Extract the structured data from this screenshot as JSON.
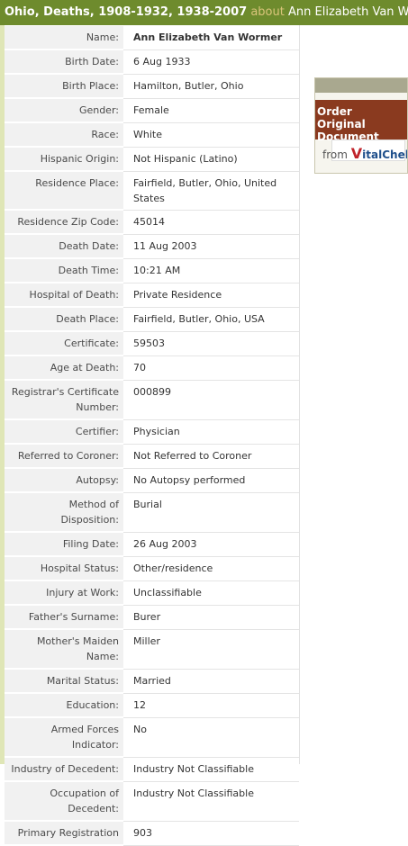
{
  "header": {
    "collection": "Ohio, Deaths, 1908-1932, 1938-2007",
    "about_word": "about",
    "person": "Ann Elizabeth Van Wormer"
  },
  "fields": [
    {
      "label": "Name:",
      "value": "Ann Elizabeth Van Wormer"
    },
    {
      "label": "Birth Date:",
      "value": "6 Aug 1933"
    },
    {
      "label": "Birth Place:",
      "value": "Hamilton, Butler, Ohio"
    },
    {
      "label": "Gender:",
      "value": "Female"
    },
    {
      "label": "Race:",
      "value": "White"
    },
    {
      "label": "Hispanic Origin:",
      "value": "Not Hispanic (Latino)"
    },
    {
      "label": "Residence Place:",
      "value": "Fairfield, Butler, Ohio, United States"
    },
    {
      "label": "Residence Zip Code:",
      "value": "45014"
    },
    {
      "label": "Death Date:",
      "value": "11 Aug 2003"
    },
    {
      "label": "Death Time:",
      "value": "10:21 AM"
    },
    {
      "label": "Hospital of Death:",
      "value": "Private Residence"
    },
    {
      "label": "Death Place:",
      "value": "Fairfield, Butler, Ohio, USA"
    },
    {
      "label": "Certificate:",
      "value": "59503"
    },
    {
      "label": "Age at Death:",
      "value": "70"
    },
    {
      "label": "Registrar's Certificate Number:",
      "value": "000899"
    },
    {
      "label": "Certifier:",
      "value": "Physician"
    },
    {
      "label": "Referred to Coroner:",
      "value": "Not Referred to Coroner"
    },
    {
      "label": "Autopsy:",
      "value": "No Autopsy performed"
    },
    {
      "label": "Method of Disposition:",
      "value": "Burial"
    },
    {
      "label": "Filing Date:",
      "value": "26 Aug 2003"
    },
    {
      "label": "Hospital Status:",
      "value": "Other/residence"
    },
    {
      "label": "Injury at Work:",
      "value": "Unclassifiable"
    },
    {
      "label": "Father's Surname:",
      "value": "Burer"
    },
    {
      "label": "Mother's Maiden Name:",
      "value": "Miller"
    },
    {
      "label": "Marital Status:",
      "value": "Married"
    },
    {
      "label": "Education:",
      "value": "12"
    },
    {
      "label": "Armed Forces Indicator:",
      "value": "No"
    },
    {
      "label": "Industry of Decedent:",
      "value": "Industry Not Classifiable"
    },
    {
      "label": "Occupation of Decedent:",
      "value": "Industry Not Classifiable"
    },
    {
      "label": "Primary Registration",
      "value": "903"
    }
  ],
  "ad": {
    "order_text": "Order Original Document",
    "from_word": "from",
    "brand_v": "V",
    "brand_rest": "italChek"
  },
  "colors": {
    "header_bg": "#6e8b2d",
    "ad_ribbon": "#8a3a1f"
  }
}
